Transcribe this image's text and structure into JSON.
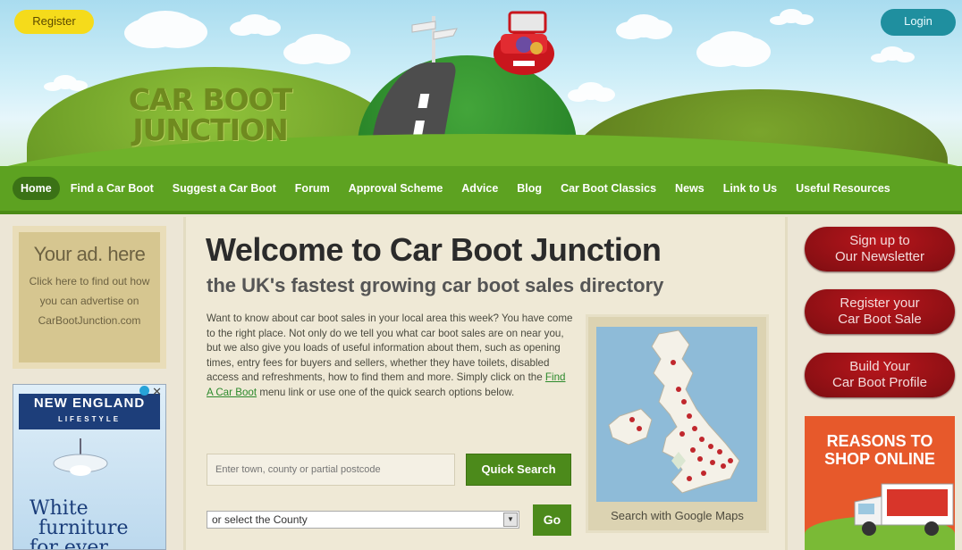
{
  "header": {
    "logo": {
      "line1": "CAR BOOT",
      "line2": "JUNCTION"
    },
    "register_label": "Register",
    "login_label": "Login"
  },
  "nav": {
    "items": [
      {
        "label": "Home",
        "active": true
      },
      {
        "label": "Find a Car Boot"
      },
      {
        "label": "Suggest a Car Boot"
      },
      {
        "label": "Forum"
      },
      {
        "label": "Approval Scheme"
      },
      {
        "label": "Advice"
      },
      {
        "label": "Blog"
      },
      {
        "label": "Car Boot Classics"
      },
      {
        "label": "News"
      },
      {
        "label": "Link to Us"
      },
      {
        "label": "Useful Resources"
      }
    ]
  },
  "sidebar_left": {
    "ad_title": "Your ad. here",
    "ad_text": "Click here to find out how you can advertise on CarBootJunction.com",
    "banner": {
      "brand": "NEW ENGLAND",
      "brand_sub": "LIFESTYLE",
      "copy_line1": "White",
      "copy_line2": "furniture",
      "copy_line3": "for ever"
    }
  },
  "main": {
    "title": "Welcome to Car Boot Junction",
    "subtitle": "the UK's fastest growing car boot sales directory",
    "intro_part1": "Want to know about car boot sales in your local area this week? You have come to the right place. Not only do we tell you what car boot sales are on near you, but we also give you loads of useful information about them, such as opening times, entry fees for buyers and sellers, whether they have toilets, disabled access and refreshments, how to find them and more. Simply click on the",
    "intro_link": "Find A Car Boot",
    "intro_part2": "menu link or use one of the quick search options below.",
    "search_placeholder": "Enter town, county or partial postcode",
    "quick_search_label": "Quick Search",
    "county_select_value": "or select the County",
    "go_label": "Go",
    "map_caption": "Search with Google Maps"
  },
  "sidebar_right": {
    "newsletter_label_1": "Sign up to",
    "newsletter_label_2": "Our Newsletter",
    "register_sale_label_1": "Register your",
    "register_sale_label_2": "Car Boot Sale",
    "profile_label_1": "Build Your",
    "profile_label_2": "Car Boot Profile",
    "promo_line1": "REASONS TO",
    "promo_line2": "SHOP ONLINE"
  },
  "colors": {
    "nav_green": "#5da221",
    "button_green": "#4c8a1b",
    "button_red": "#9c1116",
    "register_yellow": "#f5db1b",
    "login_teal": "#1f8f9f"
  }
}
